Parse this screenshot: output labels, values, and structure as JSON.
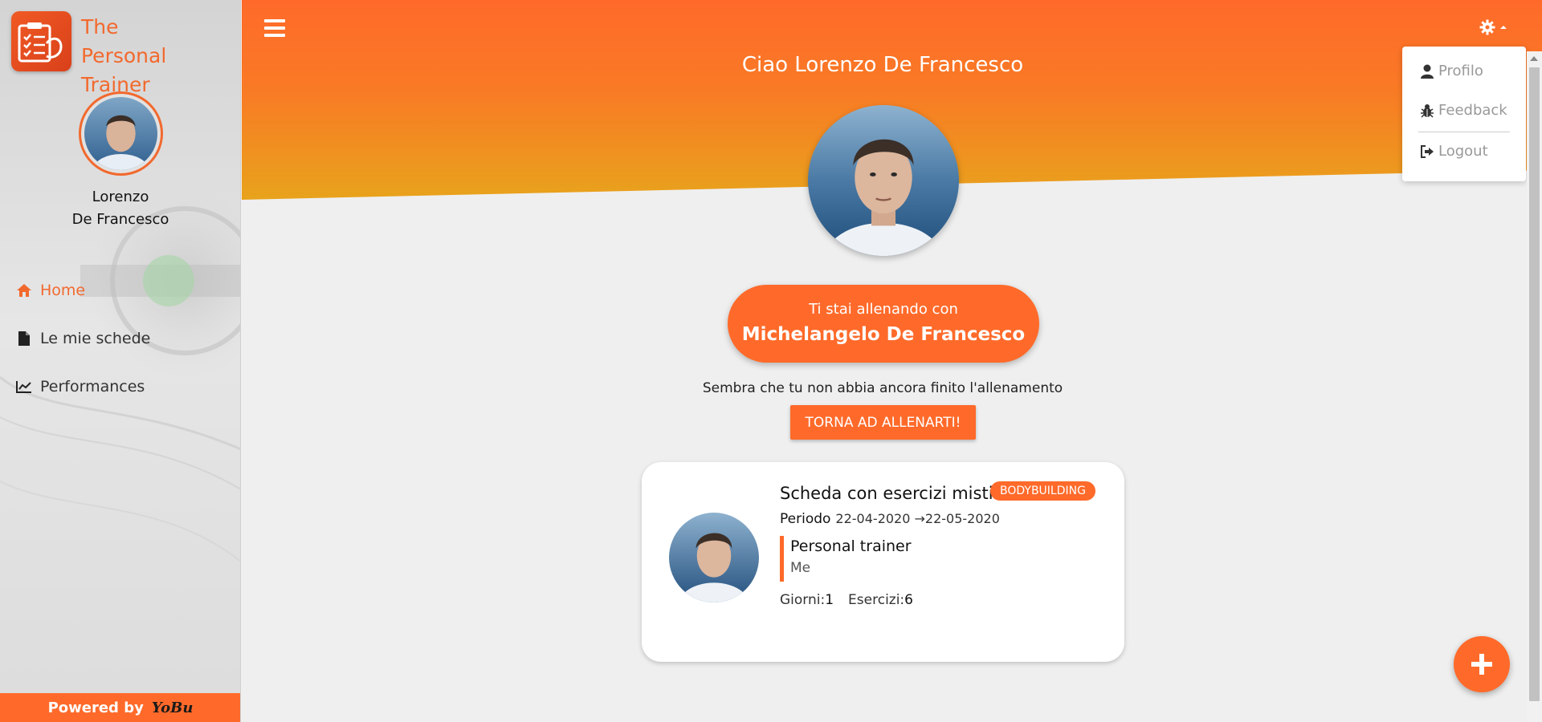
{
  "app": {
    "name_line1": "The",
    "name_line2": "Personal Trainer"
  },
  "user": {
    "first_name": "Lorenzo",
    "last_name": "De Francesco"
  },
  "sidebar": {
    "items": [
      {
        "label": "Home",
        "icon": "home-icon",
        "active": true
      },
      {
        "label": "Le mie schede",
        "icon": "document-icon"
      },
      {
        "label": "Performances",
        "icon": "line-chart-icon"
      }
    ],
    "powered_by_label": "Powered by",
    "powered_by_brand": "YoBu"
  },
  "header": {
    "greeting": "Ciao Lorenzo De Francesco"
  },
  "trainer_pill": {
    "label": "Ti stai allenando con",
    "trainer_name": "Michelangelo De Francesco"
  },
  "workout_notice": {
    "text": "Sembra che tu non abbia ancora finito l'allenamento",
    "button_label": "TORNA AD ALLENARTI!"
  },
  "card": {
    "title": "Scheda con esercizi misti",
    "badge": "BODYBUILDING",
    "period_label": "Periodo",
    "period_value": "22-04-2020 →22-05-2020",
    "trainer_label": "Personal trainer",
    "trainer_value": "Me",
    "days_label": "Giorni:",
    "days_value": "1",
    "exercises_label": "Esercizi:",
    "exercises_value": "6"
  },
  "dropdown": {
    "items": [
      {
        "label": "Profilo",
        "icon": "user-icon"
      },
      {
        "label": "Feedback",
        "icon": "bug-icon"
      },
      {
        "label": "Logout",
        "icon": "sign-out-icon"
      }
    ]
  },
  "colors": {
    "accent": "#ff6a2a",
    "header_top": "#ff6a2a",
    "header_bottom": "#e8a31c",
    "background": "#efefef"
  }
}
